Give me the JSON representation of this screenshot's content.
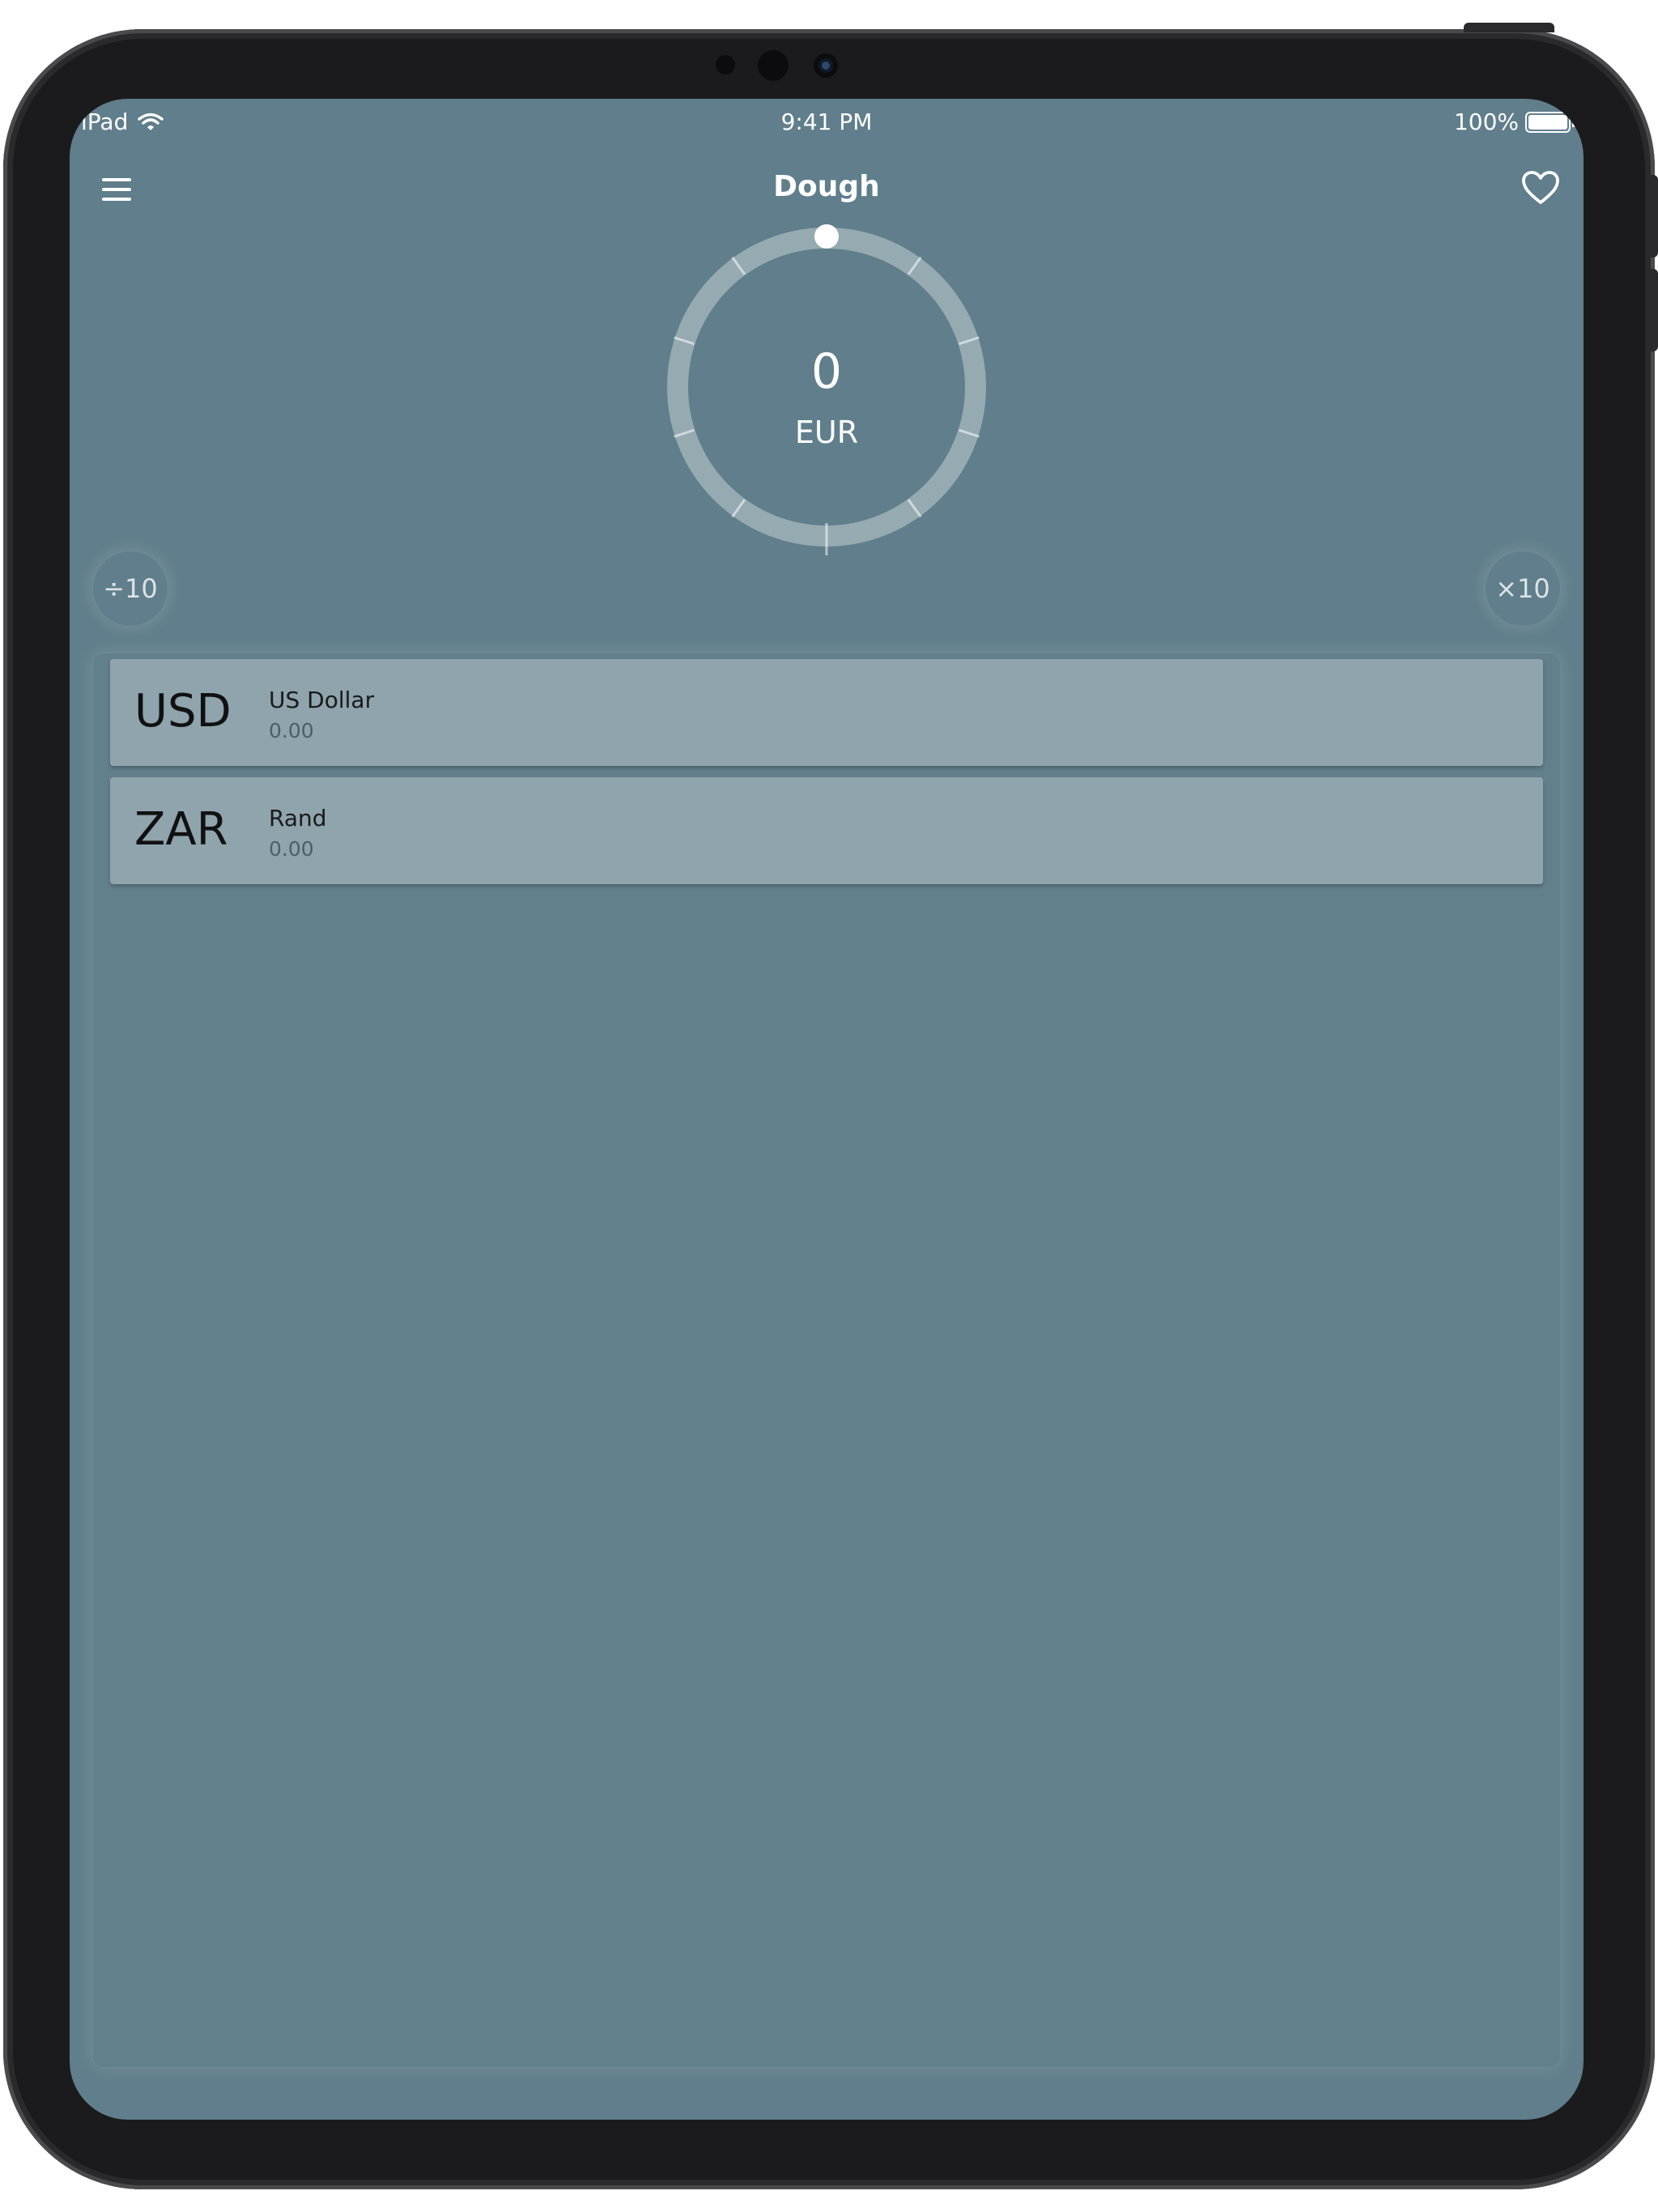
{
  "status_bar": {
    "device": "iPad",
    "time": "9:41 PM",
    "battery": "100%"
  },
  "nav": {
    "title": "Dough",
    "menu_icon": "hamburger-menu-icon",
    "favorite_icon": "heart-icon"
  },
  "dial": {
    "value": "0",
    "currency": "EUR"
  },
  "scale_buttons": {
    "divide_label": "÷10",
    "multiply_label": "×10"
  },
  "currencies": [
    {
      "code": "USD",
      "name": "US Dollar",
      "amount": "0.00"
    },
    {
      "code": "ZAR",
      "name": "Rand",
      "amount": "0.00"
    }
  ],
  "colors": {
    "background": "#607e8b",
    "row_background": "#8fa4ad",
    "text": "#ffffff"
  }
}
